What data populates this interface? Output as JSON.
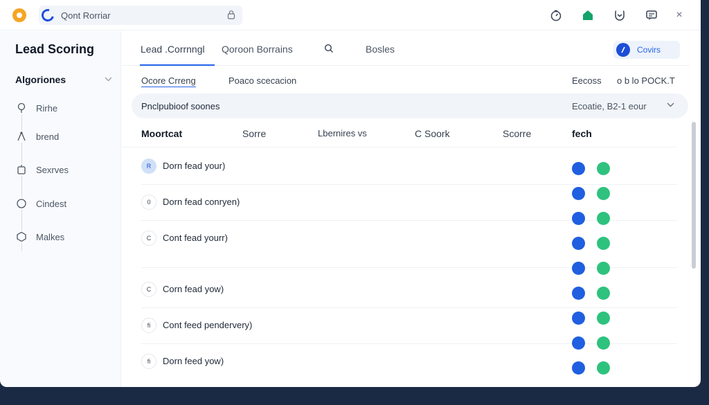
{
  "topbar": {
    "search_value": "Qont Rorriar",
    "icons": [
      "timer-icon",
      "home-icon",
      "pocket-icon",
      "chat-icon",
      "close-icon"
    ],
    "close_label": "×"
  },
  "sidebar": {
    "title": "Lead Scoring",
    "section": "Algoriones",
    "items": [
      {
        "label": "Rirhe",
        "icon": "pin-icon"
      },
      {
        "label": "brend",
        "icon": "share-icon"
      },
      {
        "label": "Sexrves",
        "icon": "package-icon"
      },
      {
        "label": "Cindest",
        "icon": "circle-icon"
      },
      {
        "label": "Malkes",
        "icon": "hexagon-icon"
      }
    ]
  },
  "tabs": [
    {
      "label": "Lead .Corrnngl"
    },
    {
      "label": "Qoroon Borrains"
    },
    {
      "label": "Bosles"
    }
  ],
  "covers_label": "Covirs",
  "subtabs": {
    "left": "Ocore Crreng",
    "middle": "Poaco scecacion",
    "right1": "Eecoss",
    "right2": "o b lo POCK.T"
  },
  "filter": {
    "text": "Pnclpubioof soones",
    "right": "Ecoatie, B2-1 eour"
  },
  "table": {
    "headers": [
      "Moortcat",
      "Sorre",
      "Lbernires vs",
      "C Soork",
      "Scorre",
      "fech"
    ],
    "rows": [
      {
        "avatar": "R",
        "name": "Dorn fead your)"
      },
      {
        "avatar": "0",
        "name": "Dorn fead conryen)"
      },
      {
        "avatar": "C",
        "name": "Cont fead yourr)"
      },
      {
        "avatar": "C",
        "name": "Corn fead yow)"
      },
      {
        "avatar": "fi",
        "name": "Cont feed pendervery)"
      },
      {
        "avatar": "fi",
        "name": "Dorn feed yow)"
      }
    ],
    "status_pairs": 9
  },
  "colors": {
    "accent": "#2563eb",
    "status_blue": "#1f5fe0",
    "status_green": "#2ec27e",
    "logo": "#f5a524"
  }
}
